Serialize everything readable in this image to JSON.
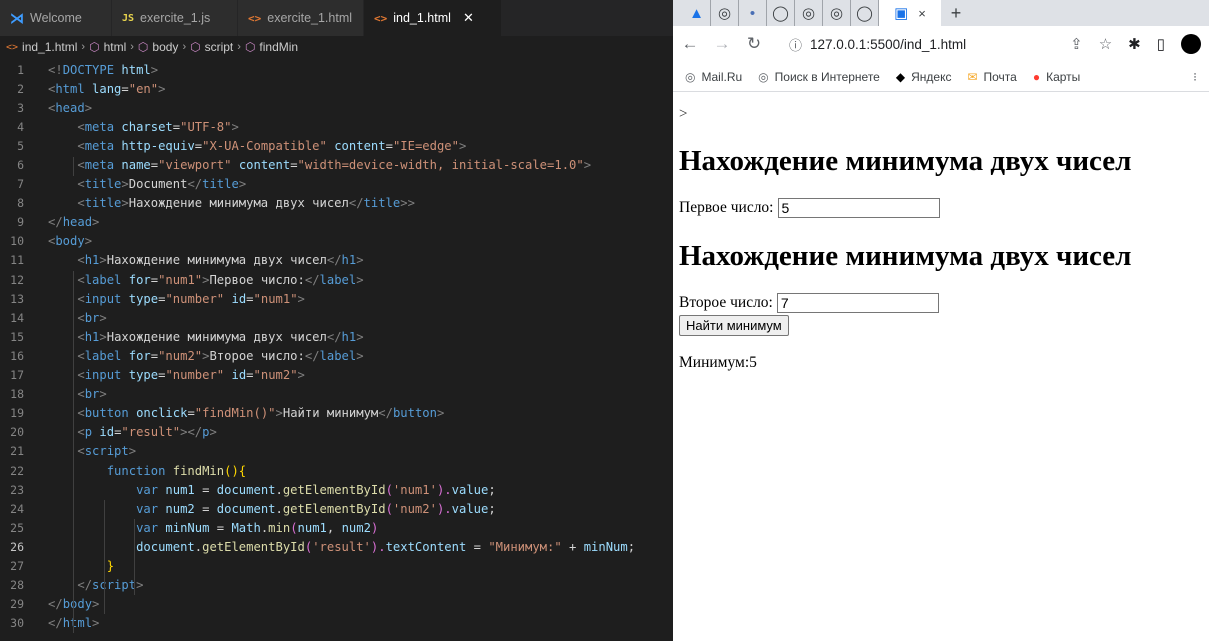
{
  "vscode": {
    "tabs": [
      {
        "icon": "vscode-logo",
        "glyph": "⋊",
        "label": "Welcome"
      },
      {
        "icon": "js-file-icon",
        "glyph": "JS",
        "label": "exercite_1.js"
      },
      {
        "icon": "html-file-icon",
        "glyph": "<>",
        "label": "exercite_1.html"
      },
      {
        "icon": "html-file-icon",
        "glyph": "<>",
        "label": "ind_1.html",
        "close": "✕"
      }
    ],
    "breadcrumb": [
      "ind_1.html",
      "html",
      "body",
      "script",
      "findMin"
    ],
    "active_line": 26,
    "lines": [
      "1",
      "2",
      "3",
      "4",
      "5",
      "6",
      "7",
      "8",
      "9",
      "10",
      "11",
      "12",
      "13",
      "14",
      "15",
      "16",
      "17",
      "18",
      "19",
      "20",
      "21",
      "22",
      "23",
      "24",
      "25",
      "26",
      "27",
      "28",
      "29",
      "30"
    ],
    "code": {
      "l1": [
        "<!",
        "DOCTYPE",
        " ",
        "html",
        ">"
      ],
      "l2": [
        "<",
        "html",
        " ",
        "lang",
        "=",
        "\"en\"",
        ">"
      ],
      "l3": [
        "<",
        "head",
        ">"
      ],
      "l4": [
        "<",
        "meta",
        " ",
        "charset",
        "=",
        "\"UTF-8\"",
        ">"
      ],
      "l5": [
        "<",
        "meta",
        " ",
        "http-equiv",
        "=",
        "\"X-UA-Compatible\"",
        " ",
        "content",
        "=",
        "\"IE=edge\"",
        ">"
      ],
      "l6": [
        "<",
        "meta",
        " ",
        "name",
        "=",
        "\"viewport\"",
        " ",
        "content",
        "=",
        "\"width=device-width, initial-scale=1.0\"",
        ">"
      ],
      "l7": [
        "<",
        "title",
        ">",
        "Document",
        "</",
        "title",
        ">"
      ],
      "l8": [
        "<",
        "title",
        ">",
        "Нахождение минимума двух чисел",
        "</",
        "title",
        ">>"
      ],
      "l9": [
        "</",
        "head",
        ">"
      ],
      "l10": [
        "<",
        "body",
        ">"
      ],
      "l11": [
        "<",
        "h1",
        ">",
        "Нахождение минимума двух чисел",
        "</",
        "h1",
        ">"
      ],
      "l12": [
        "<",
        "label",
        " ",
        "for",
        "=",
        "\"num1\"",
        ">",
        "Первое число:",
        "</",
        "label",
        ">"
      ],
      "l13": [
        "<",
        "input",
        " ",
        "type",
        "=",
        "\"number\"",
        " ",
        "id",
        "=",
        "\"num1\"",
        ">"
      ],
      "l14": [
        "<",
        "br",
        ">"
      ],
      "l15": [
        "<",
        "h1",
        ">",
        "Нахождение минимума двух чисел",
        "</",
        "h1",
        ">"
      ],
      "l16": [
        "<",
        "label",
        " ",
        "for",
        "=",
        "\"num2\"",
        ">",
        "Второе число:",
        "</",
        "label",
        ">"
      ],
      "l17": [
        "<",
        "input",
        " ",
        "type",
        "=",
        "\"number\"",
        " ",
        "id",
        "=",
        "\"num2\"",
        ">"
      ],
      "l18": [
        "<",
        "br",
        ">"
      ],
      "l19": [
        "<",
        "button",
        " ",
        "onclick",
        "=",
        "\"findMin()\"",
        ">",
        "Найти минимум",
        "</",
        "button",
        ">"
      ],
      "l20": [
        "<",
        "p",
        " ",
        "id",
        "=",
        "\"result\"",
        "></",
        "p",
        ">"
      ],
      "l21": [
        "<",
        "script",
        ">"
      ],
      "l22": [
        "function",
        " ",
        "findMin",
        "(){"
      ],
      "l23": [
        "var",
        " ",
        "num1",
        " = ",
        "document",
        ".",
        "getElementById",
        "(",
        "'num1'",
        ").",
        "value",
        ";"
      ],
      "l24": [
        "var",
        " ",
        "num2",
        " = ",
        "document",
        ".",
        "getElementById",
        "(",
        "'num2'",
        ").",
        "value",
        ";"
      ],
      "l25": [
        "var",
        " ",
        "minNum",
        " = ",
        "Math",
        ".",
        "min",
        "(",
        "num1",
        ", ",
        "num2",
        ")"
      ],
      "l26": [
        "document",
        ".",
        "getElementById",
        "(",
        "'result'",
        ").",
        "textContent",
        " = ",
        "\"Минимум:\"",
        " + ",
        "minNum",
        ";"
      ],
      "l27": [
        "}"
      ],
      "l28": [
        "</",
        "script",
        ">"
      ],
      "l29": [
        "</",
        "body",
        ">"
      ],
      "l30": [
        "</",
        "html",
        ">"
      ]
    }
  },
  "browser": {
    "tab_icons": [
      "google-drive-icon",
      "chrome-icon",
      "favicon-dot-icon",
      "github-icon",
      "chrome-icon",
      "chrome-icon",
      "github-icon",
      "chat-icon"
    ],
    "tab_glyphs": [
      "▲",
      "◎",
      "•",
      "◯",
      "◎",
      "◎",
      "◯",
      "▣"
    ],
    "tab_close": "×",
    "new_tab": "+",
    "url": "127.0.0.1:5500/ind_1.html",
    "bookmarks": [
      {
        "icon": "globe-icon",
        "glyph": "◎",
        "label": "Mail.Ru"
      },
      {
        "icon": "globe-icon",
        "glyph": "◎",
        "label": "Поиск в Интернете"
      },
      {
        "icon": "yandex-icon",
        "glyph": "◆",
        "label": "Яндекс"
      },
      {
        "icon": "mail-icon",
        "glyph": "✉",
        "label": "Почта"
      },
      {
        "icon": "map-pin-icon",
        "glyph": "●",
        "label": "Карты"
      }
    ],
    "page": {
      "stray_text": ">",
      "heading1": "Нахождение минимума двух чисел",
      "label1": "Первое число:",
      "value1": "5",
      "heading2": "Нахождение минимума двух чисел",
      "label2": "Второе число:",
      "value2": "7",
      "button": "Найти минимум",
      "result": "Минимум:5"
    }
  }
}
